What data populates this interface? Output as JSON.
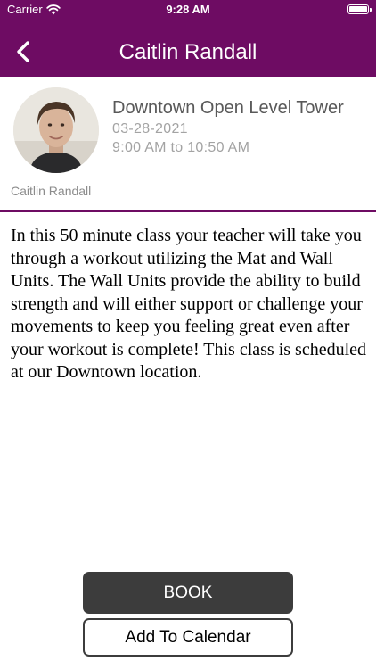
{
  "status_bar": {
    "carrier": "Carrier",
    "time": "9:28 AM",
    "wifi_icon": "wifi-icon",
    "battery_icon": "battery-icon"
  },
  "nav": {
    "title": "Caitlin Randall",
    "back_icon": "chevron-left-icon"
  },
  "class_info": {
    "instructor_name": "Caitlin Randall",
    "class_name": "Downtown Open Level Tower",
    "date": "03-28-2021",
    "time_range": "9:00 AM to 10:50 AM"
  },
  "description": "In this 50 minute class your teacher will take you through a workout utilizing the Mat and Wall Units.  The Wall Units provide the ability to build strength and will either support or challenge your movements to keep you feeling great even after your workout is complete!  This class is scheduled at our Downtown location.",
  "actions": {
    "book_label": "BOOK",
    "calendar_label": "Add To Calendar"
  },
  "colors": {
    "brand": "#6e0c63",
    "button_dark": "#3c3c3c",
    "secondary_text": "#a3a3a3"
  }
}
